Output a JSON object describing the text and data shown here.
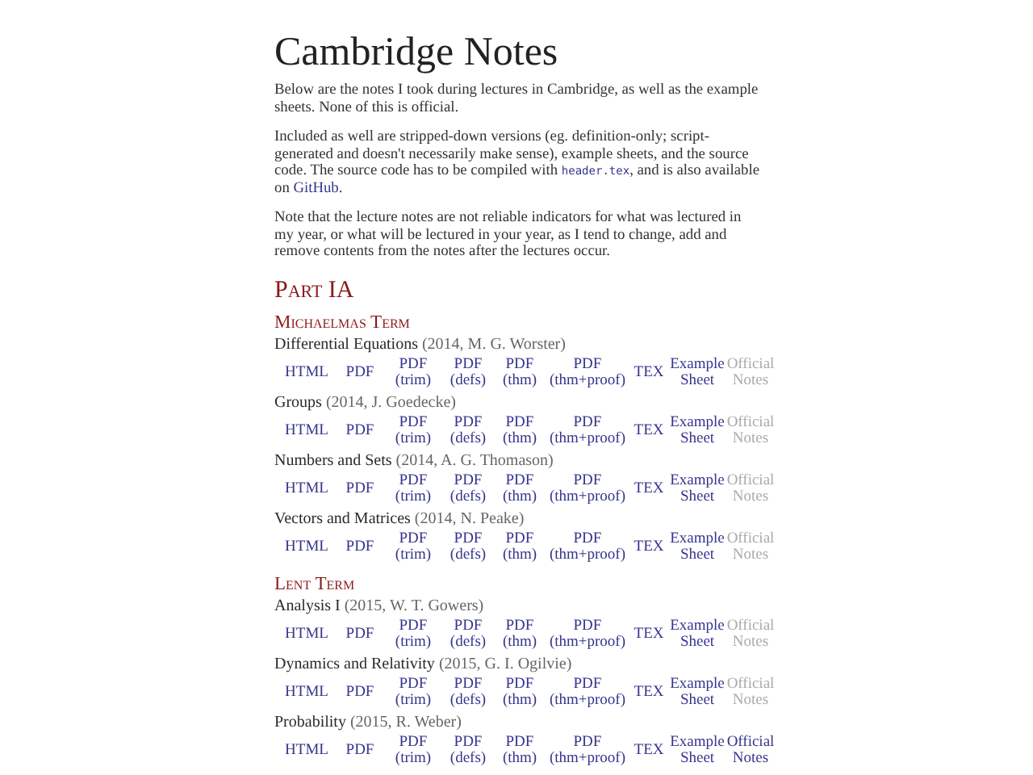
{
  "title": "Cambridge Notes",
  "intro": [
    [
      {
        "kind": "text",
        "text": "Below are the notes I took during lectures in Cambridge, as well as the example sheets. None of this is official."
      }
    ],
    [
      {
        "kind": "text",
        "text": "Included as well are stripped-down versions (eg. definition-only; script-generated and doesn't necessarily make sense), example sheets, and the source code. The source code has to be compiled with "
      },
      {
        "kind": "code",
        "text": "header.tex"
      },
      {
        "kind": "text",
        "text": ", and is also available on "
      },
      {
        "kind": "link",
        "text": "GitHub"
      },
      {
        "kind": "text",
        "text": "."
      }
    ],
    [
      {
        "kind": "text",
        "text": "Note that the lecture notes are not reliable indicators for what was lectured in my year, or what will be lectured in your year, as I tend to change, add and remove contents from the notes after the lectures occur."
      }
    ]
  ],
  "parts": [
    {
      "title": "Part IA",
      "terms": [
        {
          "title": "Michaelmas Term",
          "courses": [
            {
              "name": "Differential Equations",
              "detail": "(2014, M. G. Worster)",
              "links": [
                {
                  "lines": [
                    "HTML"
                  ],
                  "available": true
                },
                {
                  "lines": [
                    "PDF"
                  ],
                  "available": true
                },
                {
                  "lines": [
                    "PDF",
                    "(trim)"
                  ],
                  "available": true
                },
                {
                  "lines": [
                    "PDF",
                    "(defs)"
                  ],
                  "available": true
                },
                {
                  "lines": [
                    "PDF",
                    "(thm)"
                  ],
                  "available": true
                },
                {
                  "lines": [
                    "PDF",
                    "(thm+proof)"
                  ],
                  "available": true
                },
                {
                  "lines": [
                    "TEX"
                  ],
                  "available": true
                },
                {
                  "lines": [
                    "Example",
                    "Sheet"
                  ],
                  "available": true
                },
                {
                  "lines": [
                    "Official",
                    "Notes"
                  ],
                  "available": false
                }
              ]
            },
            {
              "name": "Groups",
              "detail": "(2014, J. Goedecke)",
              "links": [
                {
                  "lines": [
                    "HTML"
                  ],
                  "available": true
                },
                {
                  "lines": [
                    "PDF"
                  ],
                  "available": true
                },
                {
                  "lines": [
                    "PDF",
                    "(trim)"
                  ],
                  "available": true
                },
                {
                  "lines": [
                    "PDF",
                    "(defs)"
                  ],
                  "available": true
                },
                {
                  "lines": [
                    "PDF",
                    "(thm)"
                  ],
                  "available": true
                },
                {
                  "lines": [
                    "PDF",
                    "(thm+proof)"
                  ],
                  "available": true
                },
                {
                  "lines": [
                    "TEX"
                  ],
                  "available": true
                },
                {
                  "lines": [
                    "Example",
                    "Sheet"
                  ],
                  "available": true
                },
                {
                  "lines": [
                    "Official",
                    "Notes"
                  ],
                  "available": false
                }
              ]
            },
            {
              "name": "Numbers and Sets",
              "detail": "(2014, A. G. Thomason)",
              "links": [
                {
                  "lines": [
                    "HTML"
                  ],
                  "available": true
                },
                {
                  "lines": [
                    "PDF"
                  ],
                  "available": true
                },
                {
                  "lines": [
                    "PDF",
                    "(trim)"
                  ],
                  "available": true
                },
                {
                  "lines": [
                    "PDF",
                    "(defs)"
                  ],
                  "available": true
                },
                {
                  "lines": [
                    "PDF",
                    "(thm)"
                  ],
                  "available": true
                },
                {
                  "lines": [
                    "PDF",
                    "(thm+proof)"
                  ],
                  "available": true
                },
                {
                  "lines": [
                    "TEX"
                  ],
                  "available": true
                },
                {
                  "lines": [
                    "Example",
                    "Sheet"
                  ],
                  "available": true
                },
                {
                  "lines": [
                    "Official",
                    "Notes"
                  ],
                  "available": false
                }
              ]
            },
            {
              "name": "Vectors and Matrices",
              "detail": "(2014, N. Peake)",
              "links": [
                {
                  "lines": [
                    "HTML"
                  ],
                  "available": true
                },
                {
                  "lines": [
                    "PDF"
                  ],
                  "available": true
                },
                {
                  "lines": [
                    "PDF",
                    "(trim)"
                  ],
                  "available": true
                },
                {
                  "lines": [
                    "PDF",
                    "(defs)"
                  ],
                  "available": true
                },
                {
                  "lines": [
                    "PDF",
                    "(thm)"
                  ],
                  "available": true
                },
                {
                  "lines": [
                    "PDF",
                    "(thm+proof)"
                  ],
                  "available": true
                },
                {
                  "lines": [
                    "TEX"
                  ],
                  "available": true
                },
                {
                  "lines": [
                    "Example",
                    "Sheet"
                  ],
                  "available": true
                },
                {
                  "lines": [
                    "Official",
                    "Notes"
                  ],
                  "available": false
                }
              ]
            }
          ]
        },
        {
          "title": "Lent Term",
          "courses": [
            {
              "name": "Analysis I",
              "detail": "(2015, W. T. Gowers)",
              "links": [
                {
                  "lines": [
                    "HTML"
                  ],
                  "available": true
                },
                {
                  "lines": [
                    "PDF"
                  ],
                  "available": true
                },
                {
                  "lines": [
                    "PDF",
                    "(trim)"
                  ],
                  "available": true
                },
                {
                  "lines": [
                    "PDF",
                    "(defs)"
                  ],
                  "available": true
                },
                {
                  "lines": [
                    "PDF",
                    "(thm)"
                  ],
                  "available": true
                },
                {
                  "lines": [
                    "PDF",
                    "(thm+proof)"
                  ],
                  "available": true
                },
                {
                  "lines": [
                    "TEX"
                  ],
                  "available": true
                },
                {
                  "lines": [
                    "Example",
                    "Sheet"
                  ],
                  "available": true
                },
                {
                  "lines": [
                    "Official",
                    "Notes"
                  ],
                  "available": false
                }
              ]
            },
            {
              "name": "Dynamics and Relativity",
              "detail": "(2015, G. I. Ogilvie)",
              "links": [
                {
                  "lines": [
                    "HTML"
                  ],
                  "available": true
                },
                {
                  "lines": [
                    "PDF"
                  ],
                  "available": true
                },
                {
                  "lines": [
                    "PDF",
                    "(trim)"
                  ],
                  "available": true
                },
                {
                  "lines": [
                    "PDF",
                    "(defs)"
                  ],
                  "available": true
                },
                {
                  "lines": [
                    "PDF",
                    "(thm)"
                  ],
                  "available": true
                },
                {
                  "lines": [
                    "PDF",
                    "(thm+proof)"
                  ],
                  "available": true
                },
                {
                  "lines": [
                    "TEX"
                  ],
                  "available": true
                },
                {
                  "lines": [
                    "Example",
                    "Sheet"
                  ],
                  "available": true
                },
                {
                  "lines": [
                    "Official",
                    "Notes"
                  ],
                  "available": false
                }
              ]
            },
            {
              "name": "Probability",
              "detail": "(2015, R. Weber)",
              "links": [
                {
                  "lines": [
                    "HTML"
                  ],
                  "available": true
                },
                {
                  "lines": [
                    "PDF"
                  ],
                  "available": true
                },
                {
                  "lines": [
                    "PDF",
                    "(trim)"
                  ],
                  "available": true
                },
                {
                  "lines": [
                    "PDF",
                    "(defs)"
                  ],
                  "available": true
                },
                {
                  "lines": [
                    "PDF",
                    "(thm)"
                  ],
                  "available": true
                },
                {
                  "lines": [
                    "PDF",
                    "(thm+proof)"
                  ],
                  "available": true
                },
                {
                  "lines": [
                    "TEX"
                  ],
                  "available": true
                },
                {
                  "lines": [
                    "Example",
                    "Sheet"
                  ],
                  "available": true
                },
                {
                  "lines": [
                    "Official",
                    "Notes"
                  ],
                  "available": true
                }
              ]
            }
          ]
        }
      ]
    }
  ]
}
